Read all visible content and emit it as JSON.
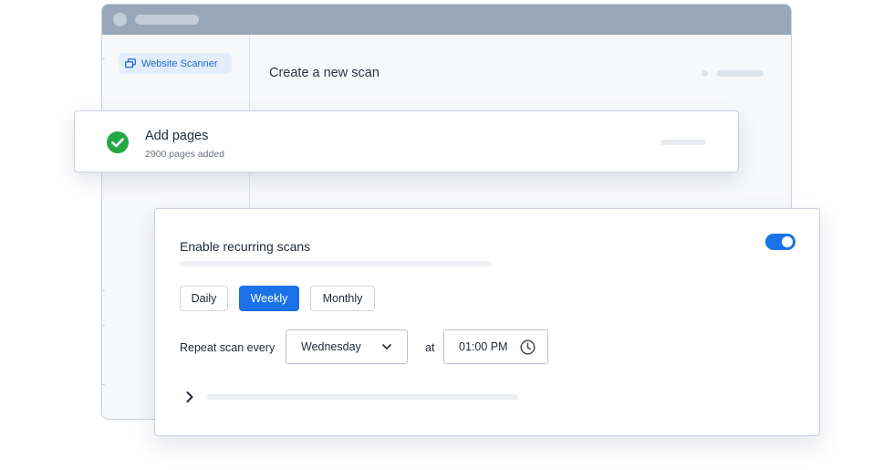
{
  "sidebar": {
    "items": [
      {
        "label": "Website Scanner",
        "icon": "window-stack-icon"
      }
    ]
  },
  "main": {
    "title": "Create a new scan"
  },
  "add_pages": {
    "title": "Add pages",
    "subtitle": "2900 pages added",
    "status_icon": "check-circle-icon",
    "status_color": "#22a745"
  },
  "recurring": {
    "title": "Enable recurring scans",
    "enabled": true,
    "frequency_options": [
      {
        "label": "Daily",
        "selected": false
      },
      {
        "label": "Weekly",
        "selected": true
      },
      {
        "label": "Monthly",
        "selected": false
      }
    ],
    "repeat_label": "Repeat scan every",
    "day_value": "Wednesday",
    "at_label": "at",
    "time_value": "01:00 PM"
  },
  "colors": {
    "accent": "#1b72e8",
    "titlebar": "#97a6b8"
  }
}
